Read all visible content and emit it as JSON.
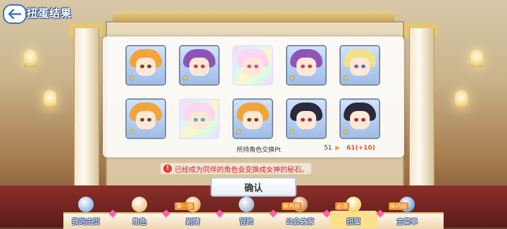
{
  "header": {
    "title": "扭蛋结果"
  },
  "cards": [
    {
      "hair": "#f3a33d",
      "eye": "#7a4a1a",
      "stars": "★",
      "rare": false
    },
    {
      "hair": "#8e55b5",
      "eye": "#c9405a",
      "stars": "★",
      "rare": false
    },
    {
      "hair": "#ffd6f2",
      "eye": "#c95a8a",
      "stars": "",
      "rare": true
    },
    {
      "hair": "#8e55b5",
      "eye": "#c9405a",
      "stars": "★",
      "rare": false
    },
    {
      "hair": "#f2e08a",
      "eye": "#5571c9",
      "stars": "★",
      "rare": false
    },
    {
      "hair": "#f3a33d",
      "eye": "#7a4a1a",
      "stars": "★",
      "rare": false
    },
    {
      "hair": "#ffd6f2",
      "eye": "#6aa3c9",
      "stars": "",
      "rare": true
    },
    {
      "hair": "#f3a33d",
      "eye": "#7a4a1a",
      "stars": "★",
      "rare": false
    },
    {
      "hair": "#2a2a3a",
      "eye": "#a5314a",
      "stars": "★",
      "rare": false
    },
    {
      "hair": "#2a2a3a",
      "eye": "#a5314a",
      "stars": "★",
      "rare": false
    }
  ],
  "exchange": {
    "label": "所持角色交换Pt",
    "before": "51",
    "after": "61(+10)"
  },
  "notice": "已经成为同伴的角色会变换成女神的秘石。",
  "confirm_label": "确认",
  "nav": [
    {
      "label": "我的主页",
      "color": "#8fb6e8"
    },
    {
      "label": "角色",
      "color": "#f2c48a",
      "tag": ""
    },
    {
      "label": "剧情",
      "color": "#e8b06a",
      "tag": "第一部"
    },
    {
      "label": "冒险",
      "color": "#a5b8d6"
    },
    {
      "label": "公会之家",
      "color": "#c98a4a",
      "tag": "新内容"
    },
    {
      "label": "扭蛋",
      "color": "#f2d36a",
      "tag": "必须"
    },
    {
      "label": "主菜单",
      "color": "#6aa6e8",
      "tag": "新内容"
    }
  ],
  "colors": {
    "accent": "#3b73c4",
    "notice": "#d7262b",
    "points_new": "#e0522c"
  }
}
